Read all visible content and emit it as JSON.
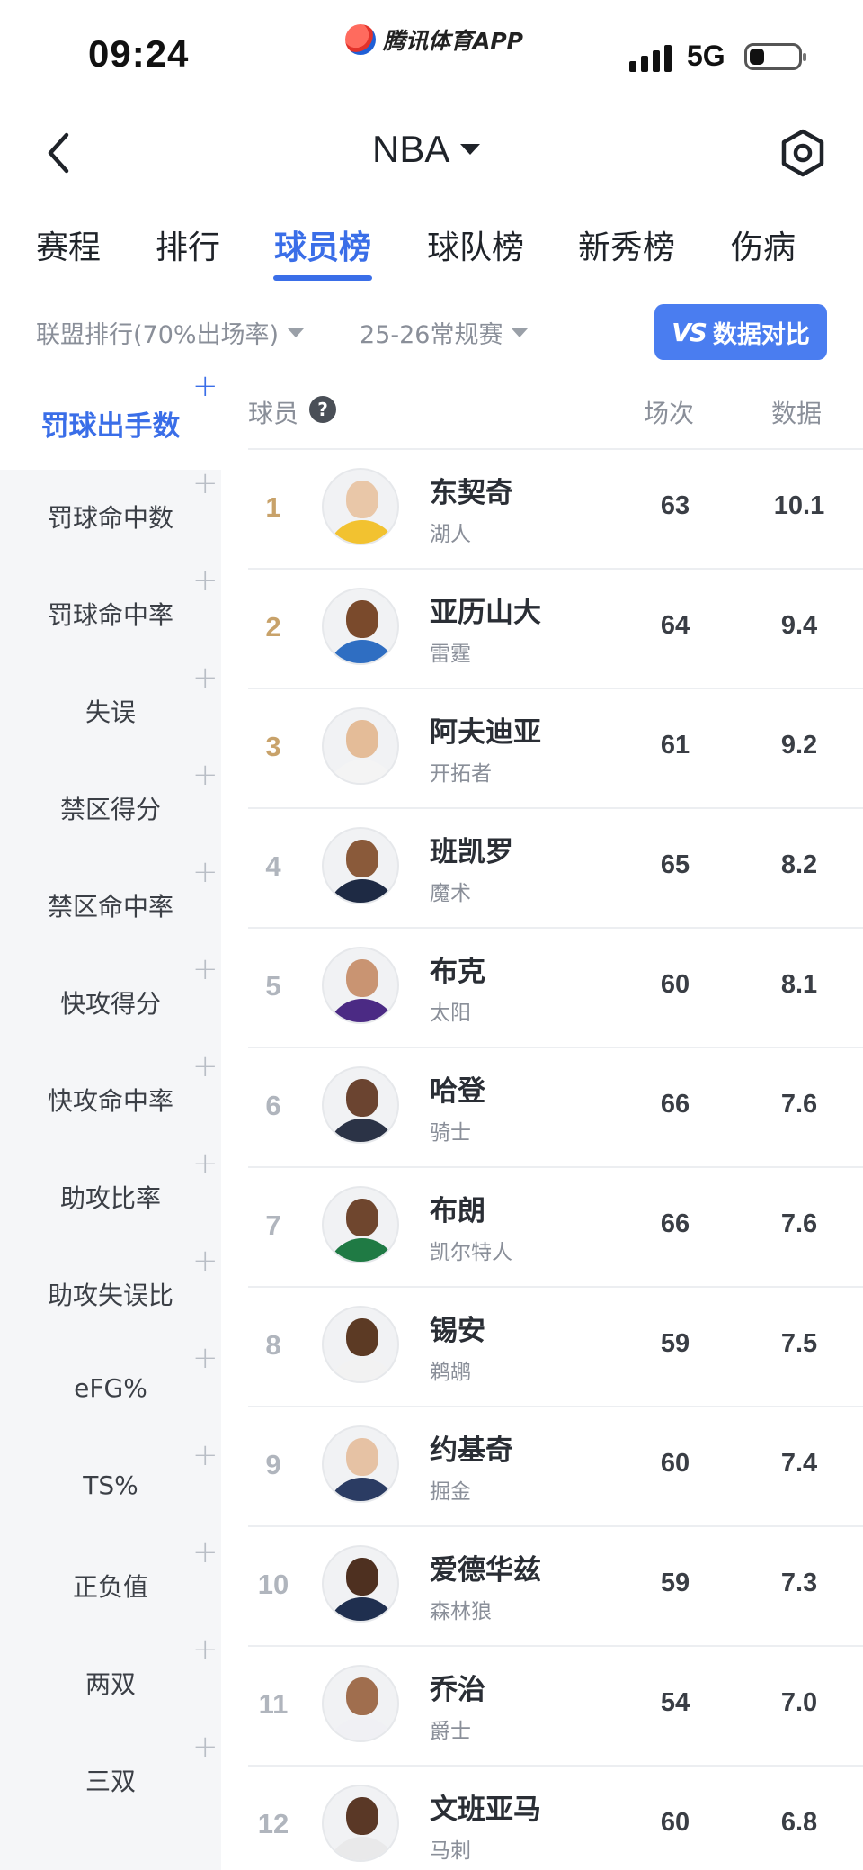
{
  "status_bar": {
    "time": "09:24",
    "network": "5G",
    "app_brand": "腾讯体育APP"
  },
  "header": {
    "title": "NBA"
  },
  "tabs": [
    {
      "label": "赛程",
      "active": false
    },
    {
      "label": "排行",
      "active": false
    },
    {
      "label": "球员榜",
      "active": true
    },
    {
      "label": "球队榜",
      "active": false
    },
    {
      "label": "新秀榜",
      "active": false
    },
    {
      "label": "伤病",
      "active": false
    }
  ],
  "filters": {
    "ranking": "联盟排行(70%出场率)",
    "season": "25-26常规赛",
    "compare_label": "数据对比",
    "compare_vs": "VS"
  },
  "sidebar": {
    "items": [
      {
        "label": "罚球出手数",
        "active": true
      },
      {
        "label": "罚球命中数",
        "active": false
      },
      {
        "label": "罚球命中率",
        "active": false
      },
      {
        "label": "失误",
        "active": false
      },
      {
        "label": "禁区得分",
        "active": false
      },
      {
        "label": "禁区命中率",
        "active": false
      },
      {
        "label": "快攻得分",
        "active": false
      },
      {
        "label": "快攻命中率",
        "active": false
      },
      {
        "label": "助攻比率",
        "active": false
      },
      {
        "label": "助攻失误比",
        "active": false
      },
      {
        "label": "eFG%",
        "active": false
      },
      {
        "label": "TS%",
        "active": false
      },
      {
        "label": "正负值",
        "active": false
      },
      {
        "label": "两双",
        "active": false
      },
      {
        "label": "三双",
        "active": false
      }
    ]
  },
  "table": {
    "headers": {
      "player": "球员",
      "games": "场次",
      "value": "数据"
    },
    "rows": [
      {
        "rank": "1",
        "name": "东契奇",
        "team": "湖人",
        "games": "63",
        "value": "10.1",
        "skin": "#e9c7a8",
        "jersey": "#f2c230"
      },
      {
        "rank": "2",
        "name": "亚历山大",
        "team": "雷霆",
        "games": "64",
        "value": "9.4",
        "skin": "#7a4a2c",
        "jersey": "#2f6ec2"
      },
      {
        "rank": "3",
        "name": "阿夫迪亚",
        "team": "开拓者",
        "games": "61",
        "value": "9.2",
        "skin": "#e4bc98",
        "jersey": "#f4f4f4"
      },
      {
        "rank": "4",
        "name": "班凯罗",
        "team": "魔术",
        "games": "65",
        "value": "8.2",
        "skin": "#8a5a3a",
        "jersey": "#1e2a44"
      },
      {
        "rank": "5",
        "name": "布克",
        "team": "太阳",
        "games": "60",
        "value": "8.1",
        "skin": "#c99472",
        "jersey": "#4b2a84"
      },
      {
        "rank": "6",
        "name": "哈登",
        "team": "骑士",
        "games": "66",
        "value": "7.6",
        "skin": "#6b4430",
        "jersey": "#2b3346"
      },
      {
        "rank": "7",
        "name": "布朗",
        "team": "凯尔特人",
        "games": "66",
        "value": "7.6",
        "skin": "#6f462e",
        "jersey": "#1f7a44"
      },
      {
        "rank": "8",
        "name": "锡安",
        "team": "鹈鹕",
        "games": "59",
        "value": "7.5",
        "skin": "#5c3a24",
        "jersey": "#f2f2f2"
      },
      {
        "rank": "9",
        "name": "约基奇",
        "team": "掘金",
        "games": "60",
        "value": "7.4",
        "skin": "#e6c2a4",
        "jersey": "#2b3c63"
      },
      {
        "rank": "10",
        "name": "爱德华兹",
        "team": "森林狼",
        "games": "59",
        "value": "7.3",
        "skin": "#4e3020",
        "jersey": "#1f2f4f"
      },
      {
        "rank": "11",
        "name": "乔治",
        "team": "爵士",
        "games": "54",
        "value": "7.0",
        "skin": "#a06e4e",
        "jersey": "#f0f0f4"
      },
      {
        "rank": "12",
        "name": "文班亚马",
        "team": "马刺",
        "games": "60",
        "value": "6.8",
        "skin": "#5a3826",
        "jersey": "#e9e9ea"
      }
    ]
  },
  "colors": {
    "accent": "#3a6ee8",
    "top_rank": "#c8a26a",
    "muted": "#8a8f99"
  }
}
